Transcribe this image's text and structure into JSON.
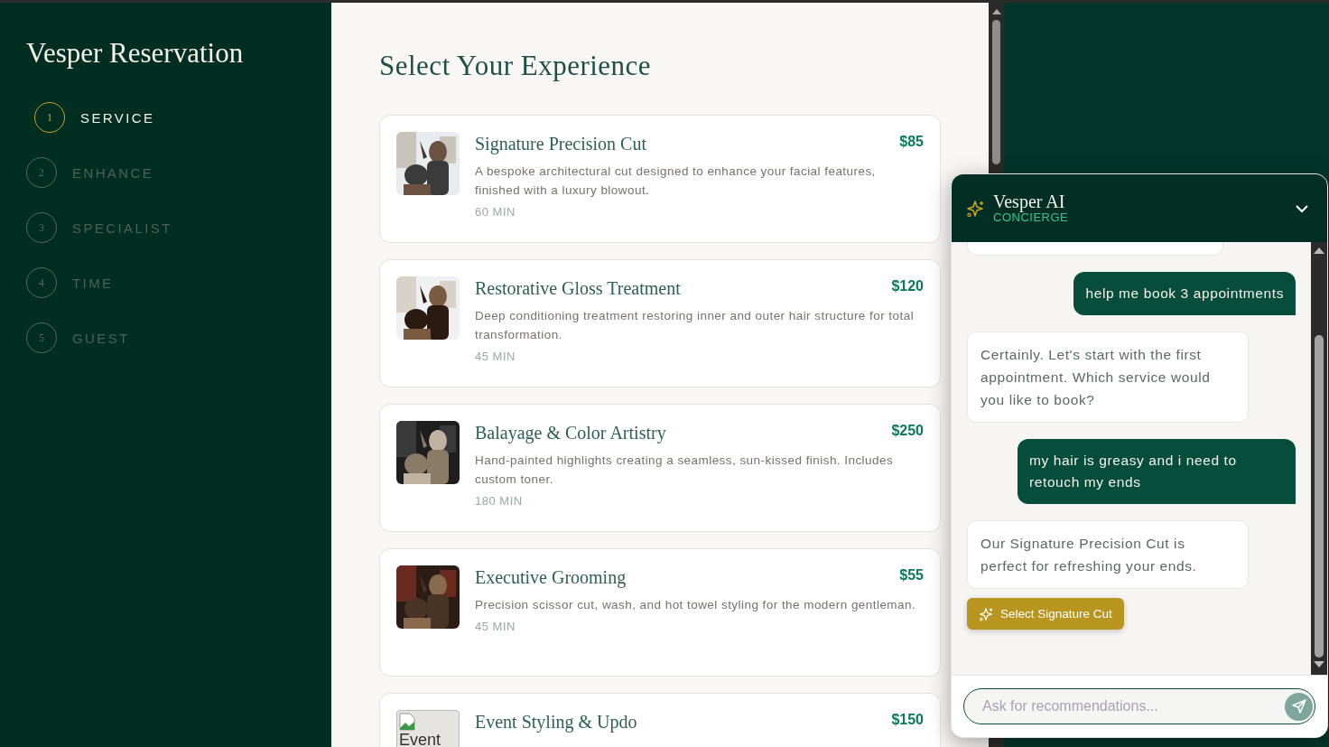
{
  "sidebar": {
    "title": "Vesper Reservation",
    "steps": [
      {
        "number": "1",
        "label": "SERVICE",
        "selected": true
      },
      {
        "number": "2",
        "label": "ENHANCE",
        "selected": false
      },
      {
        "number": "3",
        "label": "SPECIALIST",
        "selected": false
      },
      {
        "number": "4",
        "label": "TIME",
        "selected": false
      },
      {
        "number": "5",
        "label": "GUEST",
        "selected": false
      }
    ]
  },
  "main": {
    "heading": "Select Your Experience",
    "services": [
      {
        "name": "Signature Precision Cut",
        "price": "$85",
        "description": "A bespoke architectural cut designed to enhance your facial features, finished with a luxury blowout.",
        "duration": "60 MIN"
      },
      {
        "name": "Restorative Gloss Treatment",
        "price": "$120",
        "description": "Deep conditioning treatment restoring inner and outer hair structure for total transformation.",
        "duration": "45 MIN"
      },
      {
        "name": "Balayage & Color Artistry",
        "price": "$250",
        "description": "Hand-painted highlights creating a seamless, sun-kissed finish. Includes custom toner.",
        "duration": "180 MIN"
      },
      {
        "name": "Executive Grooming",
        "price": "$55",
        "description": "Precision scissor cut, wash, and hot towel styling for the modern gentleman.",
        "duration": "45 MIN"
      },
      {
        "name": "Event Styling & Updo",
        "price": "$150",
        "image": {
          "kind": "broken",
          "alt": "Event"
        }
      }
    ]
  },
  "chat": {
    "title": "Vesper AI",
    "subtitle": "CONCIERGE",
    "expanded": true,
    "messages": [
      {
        "kind": "cut"
      },
      {
        "kind": "user",
        "text": "help me book 3 appointments"
      },
      {
        "kind": "bot",
        "text": "Certainly. Let's start with the first appointment. Which service would you like to book?"
      },
      {
        "kind": "user",
        "text": "my hair is greasy and i need to retouch my ends"
      },
      {
        "kind": "bot",
        "text": "Our Signature Precision Cut is perfect for refreshing your ends."
      },
      {
        "kind": "action",
        "text": "Select Signature Cut"
      }
    ],
    "input": {
      "placeholder": "Ask for recommendations..."
    }
  }
}
